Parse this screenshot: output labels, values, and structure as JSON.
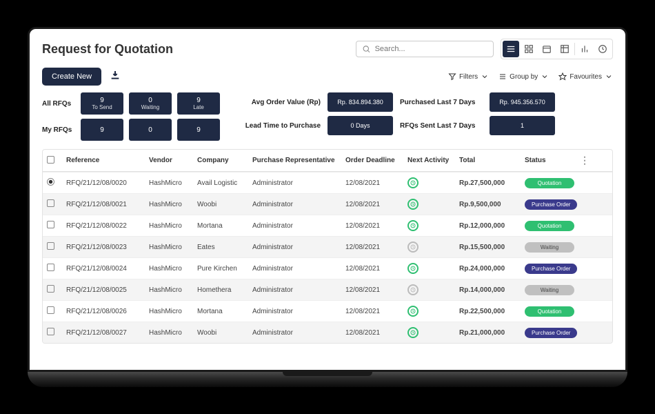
{
  "title": "Request for Quotation",
  "search": {
    "placeholder": "Search..."
  },
  "toolbar": {
    "create": "Create New",
    "filters": "Filters",
    "groupby": "Group by",
    "favourites": "Favourites"
  },
  "metrics": {
    "row1label": "All RFQs",
    "row2label": "My RFQs",
    "boxes": [
      {
        "num": "9",
        "label": "To Send"
      },
      {
        "num": "0",
        "label": "Waiting"
      },
      {
        "num": "9",
        "label": "Late"
      }
    ],
    "row2": [
      "9",
      "0",
      "9"
    ],
    "kpis": [
      {
        "label": "Avg Order Value (Rp)",
        "value": "Rp. 834.894.380",
        "label2": "Purchased Last 7 Days",
        "value2": "Rp. 945.356.570"
      },
      {
        "label": "Lead Time to Purchase",
        "value": "0 Days",
        "label2": "RFQs Sent Last 7 Days",
        "value2": "1"
      }
    ]
  },
  "columns": [
    "",
    "Reference",
    "Vendor",
    "Company",
    "Purchase Representative",
    "Order Deadline",
    "Next Activity",
    "Total",
    "Status",
    ""
  ],
  "rows": [
    {
      "ref": "RFQ/21/12/08/0020",
      "vendor": "HashMicro",
      "company": "Avail Logistic",
      "rep": "Administrator",
      "deadline": "12/08/2021",
      "activity": "green",
      "total": "Rp.27,500,000",
      "status": "Quotation",
      "statusClass": "quotation",
      "sel": "radio"
    },
    {
      "ref": "RFQ/21/12/08/0021",
      "vendor": "HashMicro",
      "company": "Woobi",
      "rep": "Administrator",
      "deadline": "12/08/2021",
      "activity": "green",
      "total": "Rp.9,500,000",
      "status": "Purchase Order",
      "statusClass": "po",
      "alt": true
    },
    {
      "ref": "RFQ/21/12/08/0022",
      "vendor": "HashMicro",
      "company": "Mortana",
      "rep": "Administrator",
      "deadline": "12/08/2021",
      "activity": "green",
      "total": "Rp.12,000,000",
      "status": "Quotation",
      "statusClass": "quotation"
    },
    {
      "ref": "RFQ/21/12/08/0023",
      "vendor": "HashMicro",
      "company": "Eates",
      "rep": "Administrator",
      "deadline": "12/08/2021",
      "activity": "grey",
      "total": "Rp.15,500,000",
      "status": "Waiting",
      "statusClass": "waiting",
      "alt": true
    },
    {
      "ref": "RFQ/21/12/08/0024",
      "vendor": "HashMicro",
      "company": "Pure Kirchen",
      "rep": "Administrator",
      "deadline": "12/08/2021",
      "activity": "green",
      "total": "Rp.24,000,000",
      "status": "Purchase Order",
      "statusClass": "po"
    },
    {
      "ref": "RFQ/21/12/08/0025",
      "vendor": "HashMicro",
      "company": "Homethera",
      "rep": "Administrator",
      "deadline": "12/08/2021",
      "activity": "grey",
      "total": "Rp.14,000,000",
      "status": "Waiting",
      "statusClass": "waiting",
      "alt": true
    },
    {
      "ref": "RFQ/21/12/08/0026",
      "vendor": "HashMicro",
      "company": "Mortana",
      "rep": "Administrator",
      "deadline": "12/08/2021",
      "activity": "green",
      "total": "Rp.22,500,000",
      "status": "Quotation",
      "statusClass": "quotation"
    },
    {
      "ref": "RFQ/21/12/08/0027",
      "vendor": "HashMicro",
      "company": "Woobi",
      "rep": "Administrator",
      "deadline": "12/08/2021",
      "activity": "green",
      "total": "Rp.21,000,000",
      "status": "Purchase Order",
      "statusClass": "po",
      "alt": true
    }
  ]
}
